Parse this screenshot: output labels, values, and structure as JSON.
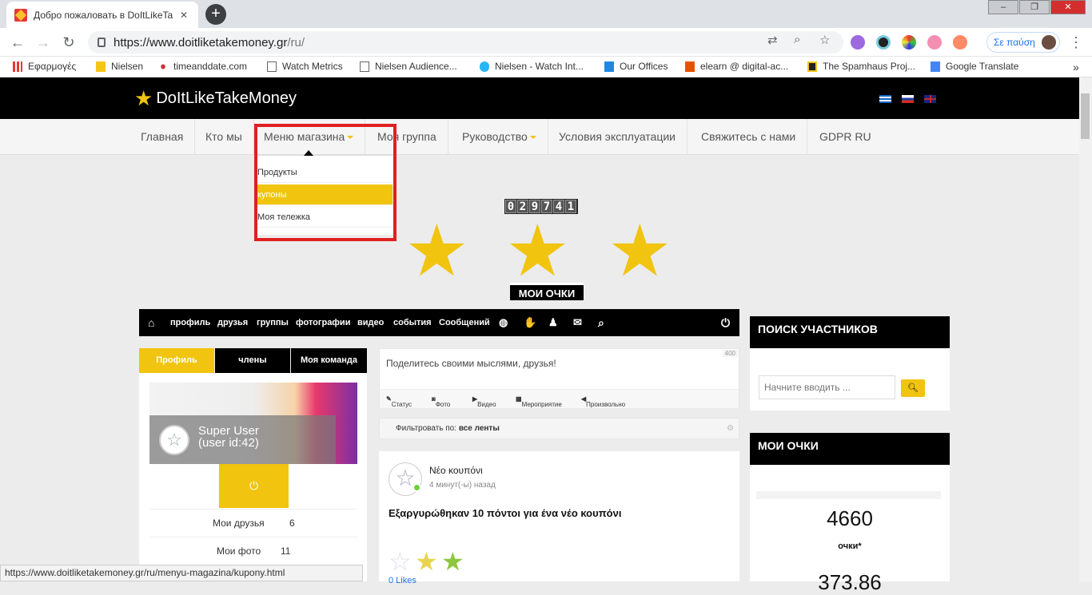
{
  "browser": {
    "tab_title": "Добро пожаловать в DoItLikeTa",
    "tab_close": "✕",
    "new_tab": "+",
    "url_host": "https://www.doitliketakemoney.gr",
    "url_path": "/ru/",
    "profile_label": "Σε παύση",
    "bookmarks": [
      "Εφαρμογές",
      "Nielsen",
      "timeanddate.com",
      "Watch Metrics",
      "Nielsen Audience...",
      "Nielsen - Watch Int...",
      "Our Offices",
      "elearn @ digital-ac...",
      "The Spamhaus Proj...",
      "Google Translate"
    ],
    "more": "»"
  },
  "site": {
    "logo_text": "DoItLikeTakeMoney",
    "menu": [
      "Главная",
      "Кто мы",
      "Меню магазина",
      "Моя группа",
      "Руководство",
      "Условия эксплуатации",
      "Свяжитесь с нами",
      "GDPR RU"
    ],
    "dropdown": [
      "Продукты",
      "купоны",
      "Моя тележка"
    ],
    "counter": [
      "0",
      "2",
      "9",
      "7",
      "4",
      "1"
    ],
    "points_badge": "МОИ ОЧКИ"
  },
  "community_bar": [
    "профиль",
    "друзья",
    "группы",
    "фотографии",
    "видео",
    "события",
    "Сообщений"
  ],
  "profile": {
    "tabs": [
      "Профиль",
      "члены",
      "Моя команда"
    ],
    "name": "Super User",
    "id": "(user id:42)",
    "stats": [
      {
        "label": "Мои друзья",
        "value": "6"
      },
      {
        "label": "Мои фото",
        "value": "11"
      }
    ]
  },
  "status": {
    "placeholder": "Поделитесь своими мыслями, друзья!",
    "char_count": "400",
    "tools": [
      "Статус",
      "Фото",
      "Видео",
      "Мероприятие",
      "Произвольно"
    ]
  },
  "filter": {
    "prefix": "Фильтровать по:",
    "value": "все ленты"
  },
  "post": {
    "author": "Νέο κουπόνι",
    "time": "4 минут(-ы) назад",
    "body": "Εξαργυρώθηκαν 10 πόντοι για ένα νέο κουπόνι",
    "likes": "0 Likes"
  },
  "sidebar": {
    "search_title": "ПОИСК УЧАСТНИКОВ",
    "search_placeholder": "Начните вводить ...",
    "points_title": "МОИ ОЧКИ",
    "points_value": "4660",
    "points_label": "очки*",
    "second_value": "373.86"
  },
  "status_url": "https://www.doitliketakemoney.gr/ru/menyu-magazina/kupony.html",
  "colors": {
    "accent": "#f1c40f",
    "header": "#000000",
    "highlight_box": "#e02020"
  }
}
